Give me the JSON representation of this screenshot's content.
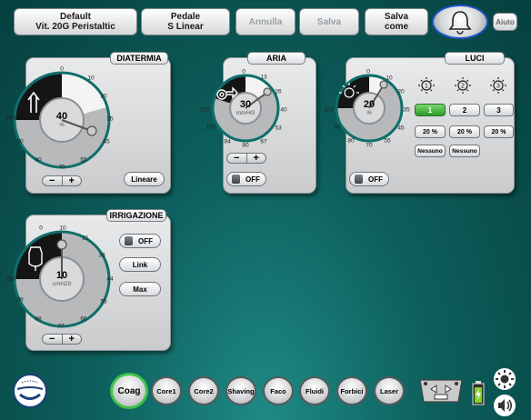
{
  "topbar": {
    "program": {
      "line1": "Default",
      "line2": "Vit. 20G Peristaltic"
    },
    "pedal": {
      "line1": "Pedale",
      "line2": "S Linear"
    },
    "cancel": "Annulla",
    "save": "Salva",
    "save_as": {
      "line1": "Salva",
      "line2": "come"
    },
    "help": "Aiuto"
  },
  "diatermia": {
    "title": "DIATERMIA",
    "value": "40",
    "unit": "%",
    "level_percent": 40,
    "ticks": [
      "0",
      "10",
      "20",
      "35",
      "45",
      "55",
      "70",
      "80",
      "90",
      "100"
    ],
    "mode_label": "Lineare"
  },
  "aria": {
    "title": "ARIA",
    "value": "30",
    "unit": "mmHG",
    "ticks": [
      "0",
      "13",
      "26",
      "40",
      "53",
      "67",
      "80",
      "94",
      "107",
      "120"
    ],
    "toggle_label": "OFF"
  },
  "luci": {
    "title": "LUCI",
    "dial_value": "20",
    "dial_unit": "%",
    "ticks": [
      "0",
      "10",
      "20",
      "35",
      "45",
      "55",
      "70",
      "80",
      "90",
      "100"
    ],
    "toggle_label": "OFF",
    "lamps": [
      {
        "number": "1",
        "intensity": "20 %",
        "filter": "Nessuno",
        "selected": true
      },
      {
        "number": "2",
        "intensity": "20 %",
        "filter": "Nessuno",
        "selected": false
      },
      {
        "number": "3",
        "intensity": "20 %",
        "filter": "",
        "selected": false
      }
    ]
  },
  "irrigazione": {
    "title": "IRRIGAZIONE",
    "value": "10",
    "unit": "cmH20",
    "ticks": [
      "0",
      "10",
      "21",
      "33",
      "44",
      "55",
      "66",
      "77",
      "88",
      "99",
      "110"
    ],
    "toggle_label": "OFF",
    "link_label": "Link",
    "max_label": "Max"
  },
  "modes": [
    "Coag",
    "Core1",
    "Core2",
    "Shaving",
    "Faco",
    "Fluidi",
    "Forbici",
    "Laser"
  ],
  "colors": {
    "accent_green": "#3fc24a",
    "background_teal": "#0d5f5c",
    "dial_dark": "#1a1a1a",
    "dial_ring": "#0f6e6a"
  }
}
